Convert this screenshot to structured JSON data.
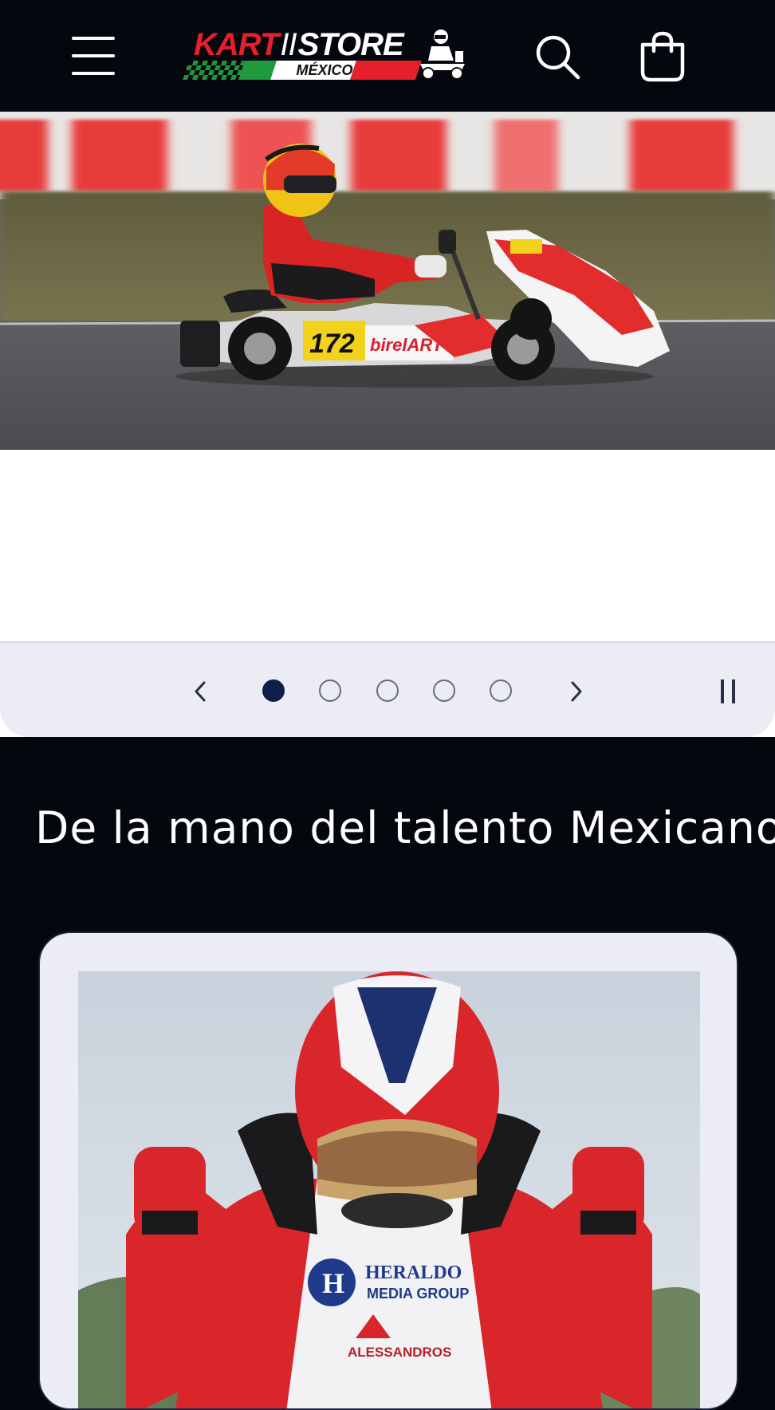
{
  "header": {
    "logo": {
      "text_kart": "KART",
      "text_separator": "II",
      "text_store": "STORE",
      "text_country": "MÉXICO",
      "colors": {
        "red": "#e5202a",
        "green": "#1f9a3d",
        "white": "#ffffff"
      }
    },
    "menu_icon": "hamburger-icon",
    "search_icon": "search-icon",
    "cart_icon": "cart-icon"
  },
  "hero": {
    "kart_number": "172",
    "sponsor_text": "birelART",
    "nose_text": "birel"
  },
  "slider": {
    "total_slides": 5,
    "active_slide": 1,
    "prev_icon": "chevron-left-icon",
    "next_icon": "chevron-right-icon",
    "pause_icon": "pause-icon"
  },
  "section": {
    "title": "De la mano del talento Mexicano"
  },
  "card": {
    "suit_sponsor_1": "HERALDO",
    "suit_sponsor_2": "MEDIA GROUP",
    "suit_sponsor_3": "ALESSANDROS",
    "suit_logo_letter": "H"
  },
  "colors": {
    "header_bg": "#05070f",
    "controls_bg": "#ebecf4",
    "active_dot": "#0f1d4a",
    "card_bg": "#ebecf6"
  }
}
